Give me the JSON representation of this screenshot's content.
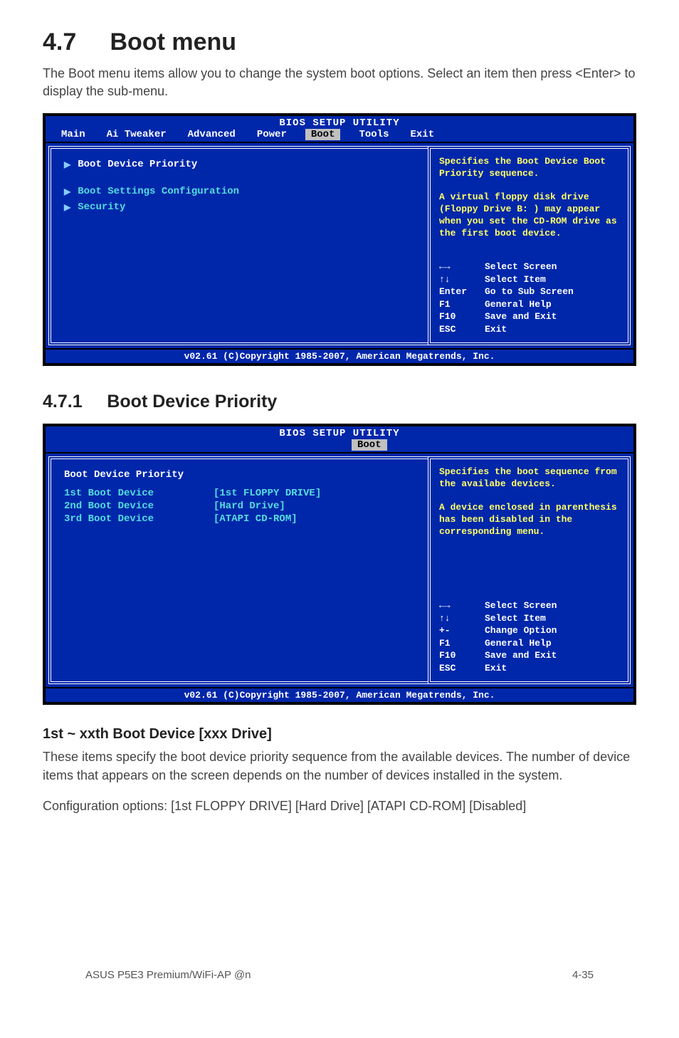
{
  "heading": {
    "number": "4.7",
    "title": "Boot menu"
  },
  "intro": "The Boot menu items allow you to change the system boot options. Select an item then press <Enter> to display the sub-menu.",
  "bios1": {
    "title": "BIOS SETUP UTILITY",
    "tabs": {
      "main": "Main",
      "ai": "Ai Tweaker",
      "adv": "Advanced",
      "power": "Power",
      "boot": "Boot",
      "tools": "Tools",
      "exit": "Exit"
    },
    "items": {
      "bootDevicePriority": "Boot Device Priority",
      "bootSettings": "Boot Settings Configuration",
      "security": "Security"
    },
    "help1": "Specifies the Boot Device Boot Priority sequence.",
    "help2": "A virtual floppy disk drive (Floppy Drive B: ) may appear when you set the CD-ROM drive as the first boot device.",
    "keys": {
      "selectScreen": "Select Screen",
      "selectItem": "Select Item",
      "enterLabel": "Enter",
      "enterDesc": "Go to Sub Screen",
      "f1Label": "F1",
      "f1Desc": "General Help",
      "f10Label": "F10",
      "f10Desc": "Save and Exit",
      "escLabel": "ESC",
      "escDesc": "Exit"
    },
    "copyright": "v02.61 (C)Copyright 1985-2007, American Megatrends, Inc."
  },
  "subheading": {
    "number": "4.7.1",
    "title": "Boot Device Priority"
  },
  "bios2": {
    "title": "BIOS SETUP UTILITY",
    "tab": "Boot",
    "heading": "Boot Device Priority",
    "rows": {
      "r1k": "1st Boot Device",
      "r1v": "[1st FLOPPY DRIVE]",
      "r2k": "2nd Boot Device",
      "r2v": "[Hard Drive]",
      "r3k": "3rd Boot Device",
      "r3v": "[ATAPI CD-ROM]"
    },
    "help1": "Specifies the boot sequence from the availabe devices.",
    "help2": "A device enclosed in parenthesis has been disabled in the corresponding menu.",
    "keys": {
      "selectScreen": "Select Screen",
      "selectItem": "Select Item",
      "pmLabel": "+-",
      "pmDesc": "Change Option",
      "f1Label": "F1",
      "f1Desc": "General Help",
      "f10Label": "F10",
      "f10Desc": "Save and Exit",
      "escLabel": "ESC",
      "escDesc": "Exit"
    },
    "copyright": "v02.61 (C)Copyright 1985-2007, American Megatrends, Inc."
  },
  "subheading2": "1st ~ xxth Boot Device [xxx Drive]",
  "para2a": "These items specify the boot device priority sequence from the available devices. The number of device items that appears on the screen depends on the number of devices installed in the system.",
  "para2b": "Configuration options: [1st FLOPPY DRIVE] [Hard Drive] [ATAPI CD-ROM] [Disabled]",
  "footer": {
    "left": "ASUS P5E3 Premium/WiFi-AP @n",
    "right": "4-35"
  }
}
